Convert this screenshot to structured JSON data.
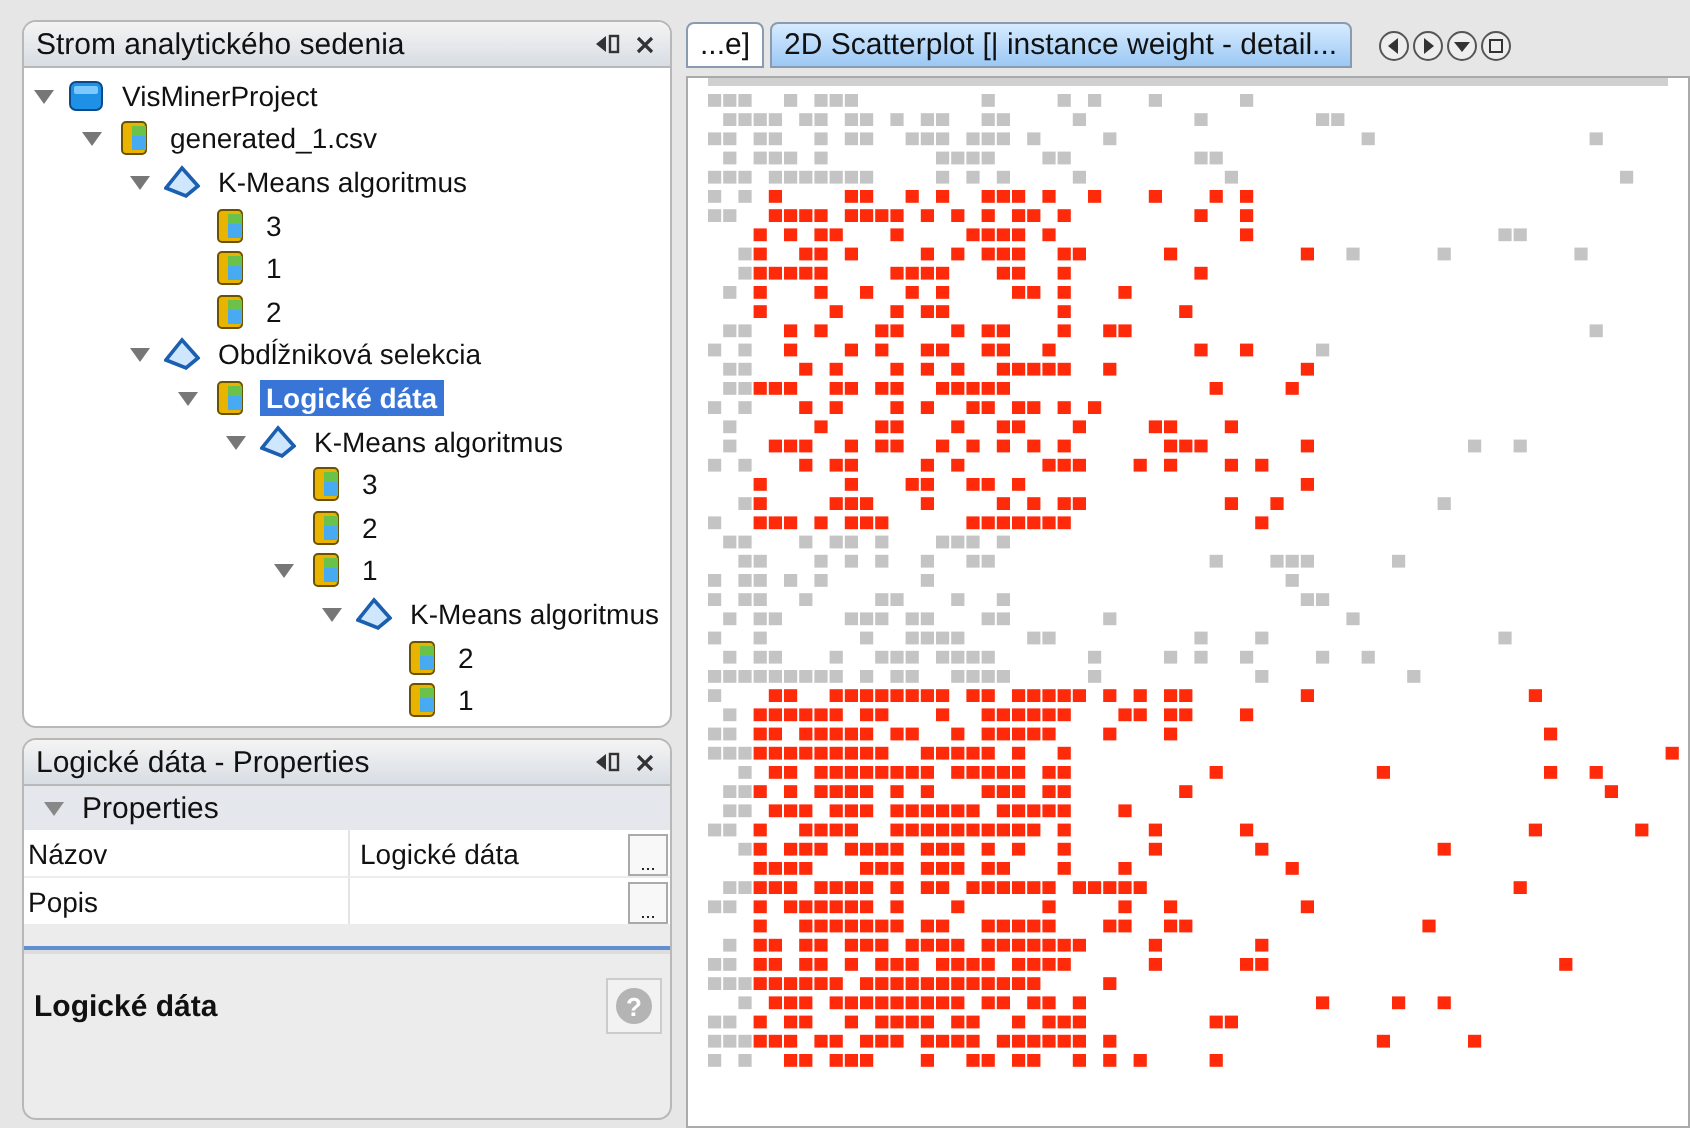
{
  "tree_panel": {
    "title": "Strom analytického sedenia",
    "items": [
      {
        "label": "VisMinerProject",
        "kind": "project",
        "expanded": true,
        "selected": false,
        "children": [
          {
            "label": "generated_1.csv",
            "kind": "data",
            "expanded": true,
            "selected": false,
            "children": [
              {
                "label": "K-Means algoritmus",
                "kind": "algorithm",
                "expanded": true,
                "selected": false,
                "children": [
                  {
                    "label": "3",
                    "kind": "data",
                    "selected": false
                  },
                  {
                    "label": "1",
                    "kind": "data",
                    "selected": false
                  },
                  {
                    "label": "2",
                    "kind": "data",
                    "selected": false
                  }
                ]
              },
              {
                "label": "Obdĺžniková selekcia",
                "kind": "algorithm",
                "expanded": true,
                "selected": false,
                "children": [
                  {
                    "label": "Logické dáta",
                    "kind": "data",
                    "expanded": true,
                    "selected": true,
                    "children": [
                      {
                        "label": "K-Means algoritmus",
                        "kind": "algorithm",
                        "expanded": true,
                        "selected": false,
                        "children": [
                          {
                            "label": "3",
                            "kind": "data",
                            "selected": false
                          },
                          {
                            "label": "2",
                            "kind": "data",
                            "selected": false
                          },
                          {
                            "label": "1",
                            "kind": "data",
                            "expanded": true,
                            "selected": false,
                            "children": [
                              {
                                "label": "K-Means algoritmus",
                                "kind": "algorithm",
                                "expanded": true,
                                "selected": false,
                                "children": [
                                  {
                                    "label": "2",
                                    "kind": "data",
                                    "selected": false
                                  },
                                  {
                                    "label": "1",
                                    "kind": "data",
                                    "selected": false
                                  }
                                ]
                              }
                            ]
                          }
                        ]
                      }
                    ]
                  }
                ]
              }
            ]
          }
        ]
      }
    ]
  },
  "properties_panel": {
    "title": "Logické dáta - Properties",
    "section": "Properties",
    "section_expanded": true,
    "rows": [
      {
        "name": "Názov",
        "value": "Logické dáta",
        "button": "..."
      },
      {
        "name": "Popis",
        "button": "..."
      }
    ],
    "description_title": "Logické dáta",
    "help_button": "?"
  },
  "editor": {
    "tabs": [
      {
        "label": "...e]",
        "selected": false
      },
      {
        "label": "2D Scatterplot [| instance weight - detail...",
        "selected": true
      }
    ]
  }
}
